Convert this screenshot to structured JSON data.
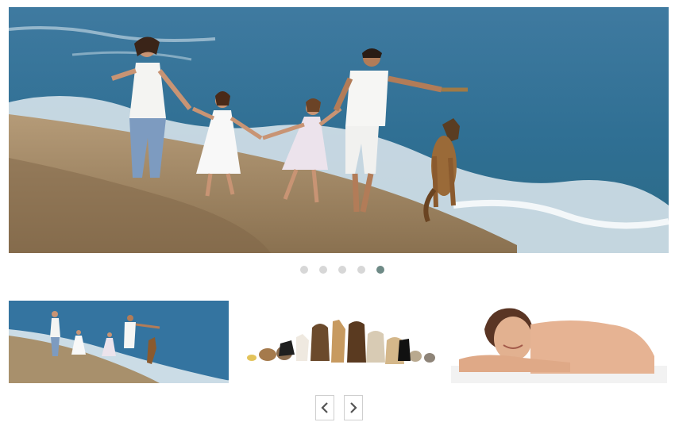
{
  "slider": {
    "slides": [
      {
        "name": "slide-1"
      },
      {
        "name": "slide-2"
      },
      {
        "name": "slide-3"
      },
      {
        "name": "slide-4"
      },
      {
        "name": "slide-5"
      }
    ],
    "active_index": 4,
    "dot_color": "#d7d7d7",
    "active_dot_color": "#6e8a86"
  },
  "thumbnails": [
    {
      "subject": "family-on-beach-photo"
    },
    {
      "subject": "pets-group-photo"
    },
    {
      "subject": "woman-spa-photo"
    }
  ],
  "navigation": {
    "prev_icon": "chevron-left-icon",
    "next_icon": "chevron-right-icon"
  }
}
